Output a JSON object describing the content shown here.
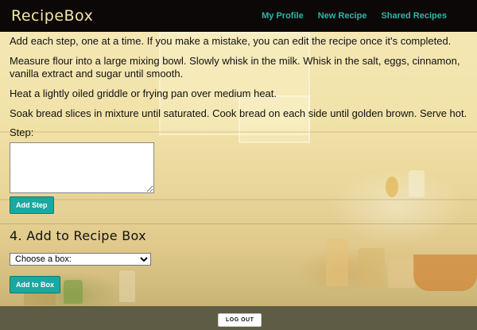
{
  "header": {
    "logo": "RecipeBox",
    "nav": [
      "My Profile",
      "New Recipe",
      "Shared Recipes"
    ]
  },
  "instructions": {
    "intro": "Add each step, one at a time. If you make a mistake, you can edit the recipe once it's completed.",
    "steps": [
      "Measure flour into a large mixing bowl. Slowly whisk in the milk. Whisk in the salt, eggs, cinnamon, vanilla extract and sugar until smooth.",
      "Heat a lightly oiled griddle or frying pan over medium heat.",
      "Soak bread slices in mixture until saturated. Cook bread on each side until golden brown. Serve hot."
    ],
    "step_label": "Step:",
    "step_value": "",
    "add_step_label": "Add Step"
  },
  "recipe_box": {
    "title": "4. Add to Recipe Box",
    "select_value": "Choose a box:",
    "add_label": "Add to Box"
  },
  "footer": {
    "logout_label": "LOG OUT"
  }
}
